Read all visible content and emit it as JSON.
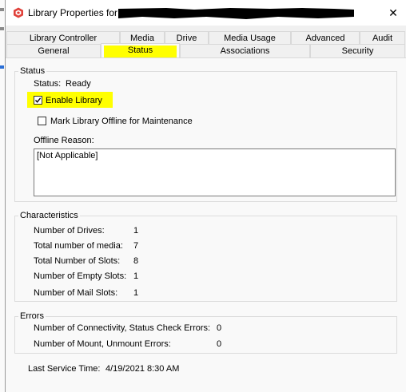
{
  "window": {
    "title": "Library Properties for",
    "close_glyph": "✕"
  },
  "tabs": {
    "back_row": [
      "Library Controller",
      "Media",
      "Drive",
      "Media Usage",
      "Advanced",
      "Audit"
    ],
    "front_row": [
      "General",
      "Status",
      "Associations",
      "Security"
    ],
    "selected": "Status"
  },
  "status_group": {
    "title": "Status",
    "status_label": "Status:",
    "status_value": "Ready",
    "enable_library_label": "Enable Library",
    "enable_library_checked": true,
    "offline_label": "Mark Library Offline for Maintenance",
    "offline_checked": false,
    "offline_reason_label": "Offline Reason:",
    "offline_reason_value": "[Not Applicable]"
  },
  "characteristics": {
    "title": "Characteristics",
    "rows": [
      {
        "label": "Number of Drives:",
        "value": "1"
      },
      {
        "label": "Total number of media:",
        "value": "7"
      },
      {
        "label": "Total Number of Slots:",
        "value": "8"
      },
      {
        "label": "Number of Empty Slots:",
        "value": "1"
      },
      {
        "label": "Number of Mail Slots:",
        "value": "1"
      }
    ]
  },
  "errors": {
    "title": "Errors",
    "rows": [
      {
        "label": "Number of Connectivity, Status Check Errors:",
        "value": "0"
      },
      {
        "label": "Number of Mount, Unmount Errors:",
        "value": "0"
      }
    ]
  },
  "service": {
    "label": "Last Service Time:",
    "value": "4/19/2021 8:30 AM"
  },
  "colors": {
    "highlight": "#ffff00",
    "app_icon": "#e0413a"
  }
}
